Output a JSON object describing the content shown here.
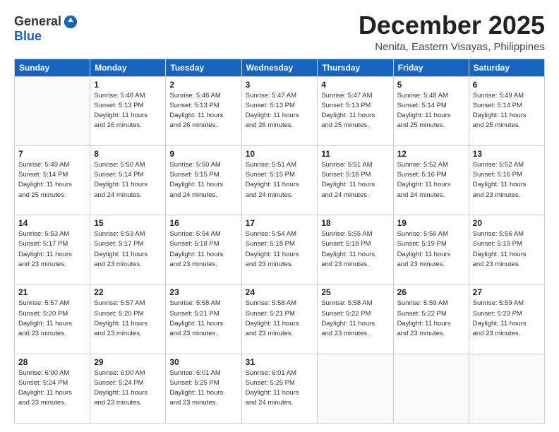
{
  "header": {
    "logo_general": "General",
    "logo_blue": "Blue",
    "month_year": "December 2025",
    "location": "Nenita, Eastern Visayas, Philippines"
  },
  "days_of_week": [
    "Sunday",
    "Monday",
    "Tuesday",
    "Wednesday",
    "Thursday",
    "Friday",
    "Saturday"
  ],
  "weeks": [
    [
      {
        "day": "",
        "info": ""
      },
      {
        "day": "1",
        "info": "Sunrise: 5:46 AM\nSunset: 5:13 PM\nDaylight: 11 hours\nand 26 minutes."
      },
      {
        "day": "2",
        "info": "Sunrise: 5:46 AM\nSunset: 5:13 PM\nDaylight: 11 hours\nand 26 minutes."
      },
      {
        "day": "3",
        "info": "Sunrise: 5:47 AM\nSunset: 5:13 PM\nDaylight: 11 hours\nand 26 minutes."
      },
      {
        "day": "4",
        "info": "Sunrise: 5:47 AM\nSunset: 5:13 PM\nDaylight: 11 hours\nand 25 minutes."
      },
      {
        "day": "5",
        "info": "Sunrise: 5:48 AM\nSunset: 5:14 PM\nDaylight: 11 hours\nand 25 minutes."
      },
      {
        "day": "6",
        "info": "Sunrise: 5:49 AM\nSunset: 5:14 PM\nDaylight: 11 hours\nand 25 minutes."
      }
    ],
    [
      {
        "day": "7",
        "info": "Sunrise: 5:49 AM\nSunset: 5:14 PM\nDaylight: 11 hours\nand 25 minutes."
      },
      {
        "day": "8",
        "info": "Sunrise: 5:50 AM\nSunset: 5:14 PM\nDaylight: 11 hours\nand 24 minutes."
      },
      {
        "day": "9",
        "info": "Sunrise: 5:50 AM\nSunset: 5:15 PM\nDaylight: 11 hours\nand 24 minutes."
      },
      {
        "day": "10",
        "info": "Sunrise: 5:51 AM\nSunset: 5:15 PM\nDaylight: 11 hours\nand 24 minutes."
      },
      {
        "day": "11",
        "info": "Sunrise: 5:51 AM\nSunset: 5:16 PM\nDaylight: 11 hours\nand 24 minutes."
      },
      {
        "day": "12",
        "info": "Sunrise: 5:52 AM\nSunset: 5:16 PM\nDaylight: 11 hours\nand 24 minutes."
      },
      {
        "day": "13",
        "info": "Sunrise: 5:52 AM\nSunset: 5:16 PM\nDaylight: 11 hours\nand 23 minutes."
      }
    ],
    [
      {
        "day": "14",
        "info": "Sunrise: 5:53 AM\nSunset: 5:17 PM\nDaylight: 11 hours\nand 23 minutes."
      },
      {
        "day": "15",
        "info": "Sunrise: 5:53 AM\nSunset: 5:17 PM\nDaylight: 11 hours\nand 23 minutes."
      },
      {
        "day": "16",
        "info": "Sunrise: 5:54 AM\nSunset: 5:18 PM\nDaylight: 11 hours\nand 23 minutes."
      },
      {
        "day": "17",
        "info": "Sunrise: 5:54 AM\nSunset: 5:18 PM\nDaylight: 11 hours\nand 23 minutes."
      },
      {
        "day": "18",
        "info": "Sunrise: 5:55 AM\nSunset: 5:18 PM\nDaylight: 11 hours\nand 23 minutes."
      },
      {
        "day": "19",
        "info": "Sunrise: 5:56 AM\nSunset: 5:19 PM\nDaylight: 11 hours\nand 23 minutes."
      },
      {
        "day": "20",
        "info": "Sunrise: 5:56 AM\nSunset: 5:19 PM\nDaylight: 11 hours\nand 23 minutes."
      }
    ],
    [
      {
        "day": "21",
        "info": "Sunrise: 5:57 AM\nSunset: 5:20 PM\nDaylight: 11 hours\nand 23 minutes."
      },
      {
        "day": "22",
        "info": "Sunrise: 5:57 AM\nSunset: 5:20 PM\nDaylight: 11 hours\nand 23 minutes."
      },
      {
        "day": "23",
        "info": "Sunrise: 5:58 AM\nSunset: 5:21 PM\nDaylight: 11 hours\nand 23 minutes."
      },
      {
        "day": "24",
        "info": "Sunrise: 5:58 AM\nSunset: 5:21 PM\nDaylight: 11 hours\nand 23 minutes."
      },
      {
        "day": "25",
        "info": "Sunrise: 5:58 AM\nSunset: 5:22 PM\nDaylight: 11 hours\nand 23 minutes."
      },
      {
        "day": "26",
        "info": "Sunrise: 5:59 AM\nSunset: 5:22 PM\nDaylight: 11 hours\nand 23 minutes."
      },
      {
        "day": "27",
        "info": "Sunrise: 5:59 AM\nSunset: 5:23 PM\nDaylight: 11 hours\nand 23 minutes."
      }
    ],
    [
      {
        "day": "28",
        "info": "Sunrise: 6:00 AM\nSunset: 5:24 PM\nDaylight: 11 hours\nand 23 minutes."
      },
      {
        "day": "29",
        "info": "Sunrise: 6:00 AM\nSunset: 5:24 PM\nDaylight: 11 hours\nand 23 minutes."
      },
      {
        "day": "30",
        "info": "Sunrise: 6:01 AM\nSunset: 5:25 PM\nDaylight: 11 hours\nand 23 minutes."
      },
      {
        "day": "31",
        "info": "Sunrise: 6:01 AM\nSunset: 5:25 PM\nDaylight: 11 hours\nand 24 minutes."
      },
      {
        "day": "",
        "info": ""
      },
      {
        "day": "",
        "info": ""
      },
      {
        "day": "",
        "info": ""
      }
    ]
  ]
}
